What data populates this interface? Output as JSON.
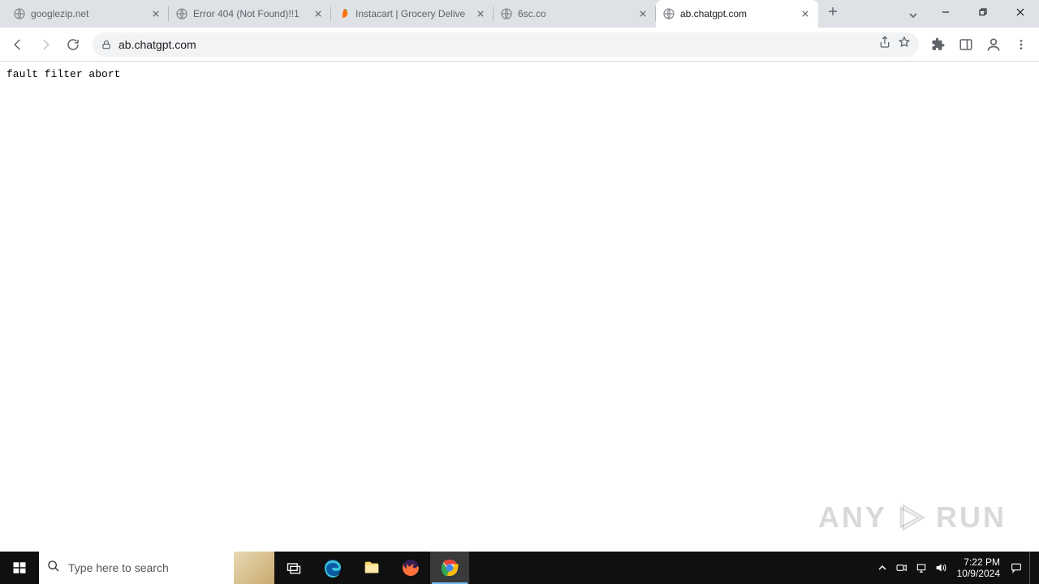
{
  "browser": {
    "tabs": [
      {
        "label": "googlezip.net",
        "favicon": "globe",
        "active": false
      },
      {
        "label": "Error 404 (Not Found)!!1",
        "favicon": "globe",
        "active": false
      },
      {
        "label": "Instacart | Grocery Delive",
        "favicon": "instacart",
        "active": false
      },
      {
        "label": "6sc.co",
        "favicon": "globe",
        "active": false
      },
      {
        "label": "ab.chatgpt.com",
        "favicon": "globe",
        "active": true
      }
    ],
    "address": {
      "url": "ab.chatgpt.com"
    }
  },
  "page": {
    "body_text": "fault filter abort"
  },
  "watermark": {
    "text_a": "ANY",
    "text_b": "RUN"
  },
  "taskbar": {
    "search_placeholder": "Type here to search",
    "clock_time": "7:22 PM",
    "clock_date": "10/9/2024"
  }
}
